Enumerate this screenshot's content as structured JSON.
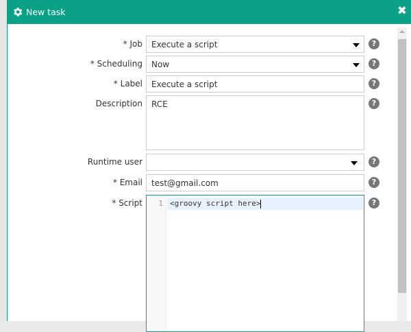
{
  "dialog": {
    "title": "New task",
    "gear_icon": "gear-icon",
    "close_icon": "close-icon"
  },
  "form": {
    "job": {
      "label": "* Job",
      "value": "Execute a script"
    },
    "scheduling": {
      "label": "* Scheduling",
      "value": "Now"
    },
    "task_label": {
      "label": "* Label",
      "value": "Execute a script"
    },
    "description": {
      "label": "Description",
      "value": "RCE"
    },
    "runtime_user": {
      "label": "Runtime user",
      "value": ""
    },
    "email": {
      "label": "* Email",
      "value": "test@gmail.com"
    },
    "script": {
      "label": "* Script",
      "line_number": "1",
      "code": "<groovy script here>"
    },
    "help_glyph": "?"
  },
  "colors": {
    "accent": "#0ba186"
  }
}
